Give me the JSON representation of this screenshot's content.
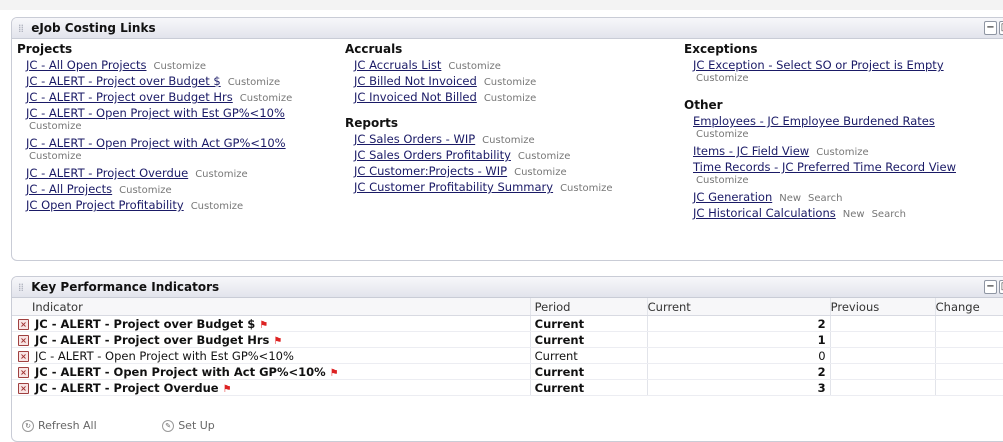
{
  "links_portlet": {
    "title": "eJob Costing Links",
    "columns": [
      {
        "sections": [
          {
            "heading": "Projects",
            "links": [
              {
                "label": "JC - All Open Projects",
                "extras": [
                  "Customize"
                ],
                "wrap": false
              },
              {
                "label": "JC - ALERT - Project over Budget $",
                "extras": [
                  "Customize"
                ],
                "wrap": false
              },
              {
                "label": "JC - ALERT - Project over Budget Hrs",
                "extras": [
                  "Customize"
                ],
                "wrap": false
              },
              {
                "label": "JC - ALERT - Open Project with Est GP%<10%",
                "extras": [
                  "Customize"
                ],
                "wrap": true
              },
              {
                "label": "JC - ALERT - Open Project with Act GP%<10%",
                "extras": [
                  "Customize"
                ],
                "wrap": true
              },
              {
                "label": "JC - ALERT - Project Overdue",
                "extras": [
                  "Customize"
                ],
                "wrap": false
              },
              {
                "label": "JC - All Projects",
                "extras": [
                  "Customize"
                ],
                "wrap": false
              },
              {
                "label": "JC Open Project Profitability",
                "extras": [
                  "Customize"
                ],
                "wrap": false
              }
            ]
          }
        ]
      },
      {
        "sections": [
          {
            "heading": "Accruals",
            "links": [
              {
                "label": "JC Accruals List",
                "extras": [
                  "Customize"
                ],
                "wrap": false
              },
              {
                "label": "JC Billed Not Invoiced",
                "extras": [
                  "Customize"
                ],
                "wrap": false
              },
              {
                "label": "JC Invoiced Not Billed",
                "extras": [
                  "Customize"
                ],
                "wrap": false
              }
            ]
          },
          {
            "heading": "Reports",
            "links": [
              {
                "label": "JC Sales Orders - WIP",
                "extras": [
                  "Customize"
                ],
                "wrap": false
              },
              {
                "label": "JC Sales Orders Profitability",
                "extras": [
                  "Customize"
                ],
                "wrap": false
              },
              {
                "label": "JC Customer:Projects - WIP",
                "extras": [
                  "Customize"
                ],
                "wrap": false
              },
              {
                "label": "JC Customer Profitability Summary",
                "extras": [
                  "Customize"
                ],
                "wrap": false
              }
            ]
          }
        ]
      },
      {
        "sections": [
          {
            "heading": "Exceptions",
            "links": [
              {
                "label": "JC Exception - Select SO or Project is Empty",
                "extras": [
                  "Customize"
                ],
                "wrap": true
              }
            ]
          },
          {
            "heading": "Other",
            "links": [
              {
                "label": "Employees - JC Employee Burdened Rates",
                "extras": [
                  "Customize"
                ],
                "wrap": true
              },
              {
                "label": "Items - JC Field View",
                "extras": [
                  "Customize"
                ],
                "wrap": false
              },
              {
                "label": "Time Records - JC Preferred Time Record View",
                "extras": [
                  "Customize"
                ],
                "wrap": true
              },
              {
                "label": "JC Generation",
                "extras": [
                  "New",
                  "Search"
                ],
                "wrap": false
              },
              {
                "label": "JC Historical Calculations",
                "extras": [
                  "New",
                  "Search"
                ],
                "wrap": false
              }
            ]
          }
        ]
      }
    ]
  },
  "kpi_portlet": {
    "title": "Key Performance Indicators",
    "columns": {
      "indicator": "Indicator",
      "period": "Period",
      "current": "Current",
      "previous": "Previous",
      "change": "Change"
    },
    "rows": [
      {
        "indicator": "JC - ALERT - Project over Budget $",
        "period": "Current",
        "current": "2",
        "previous": "",
        "change": "",
        "bold": true,
        "flag": true
      },
      {
        "indicator": "JC - ALERT - Project over Budget Hrs",
        "period": "Current",
        "current": "1",
        "previous": "",
        "change": "",
        "bold": true,
        "flag": true
      },
      {
        "indicator": "JC - ALERT - Open Project with Est GP%<10%",
        "period": "Current",
        "current": "0",
        "previous": "",
        "change": "",
        "bold": false,
        "flag": false
      },
      {
        "indicator": "JC - ALERT - Open Project with Act GP%<10%",
        "period": "Current",
        "current": "2",
        "previous": "",
        "change": "",
        "bold": true,
        "flag": true
      },
      {
        "indicator": "JC - ALERT - Project Overdue",
        "period": "Current",
        "current": "3",
        "previous": "",
        "change": "",
        "bold": true,
        "flag": true
      }
    ],
    "footer": {
      "refresh_label": "Refresh All",
      "setup_label": "Set Up"
    }
  },
  "header_controls": {
    "minimize_glyph": "−",
    "maximize_glyph": "□"
  }
}
